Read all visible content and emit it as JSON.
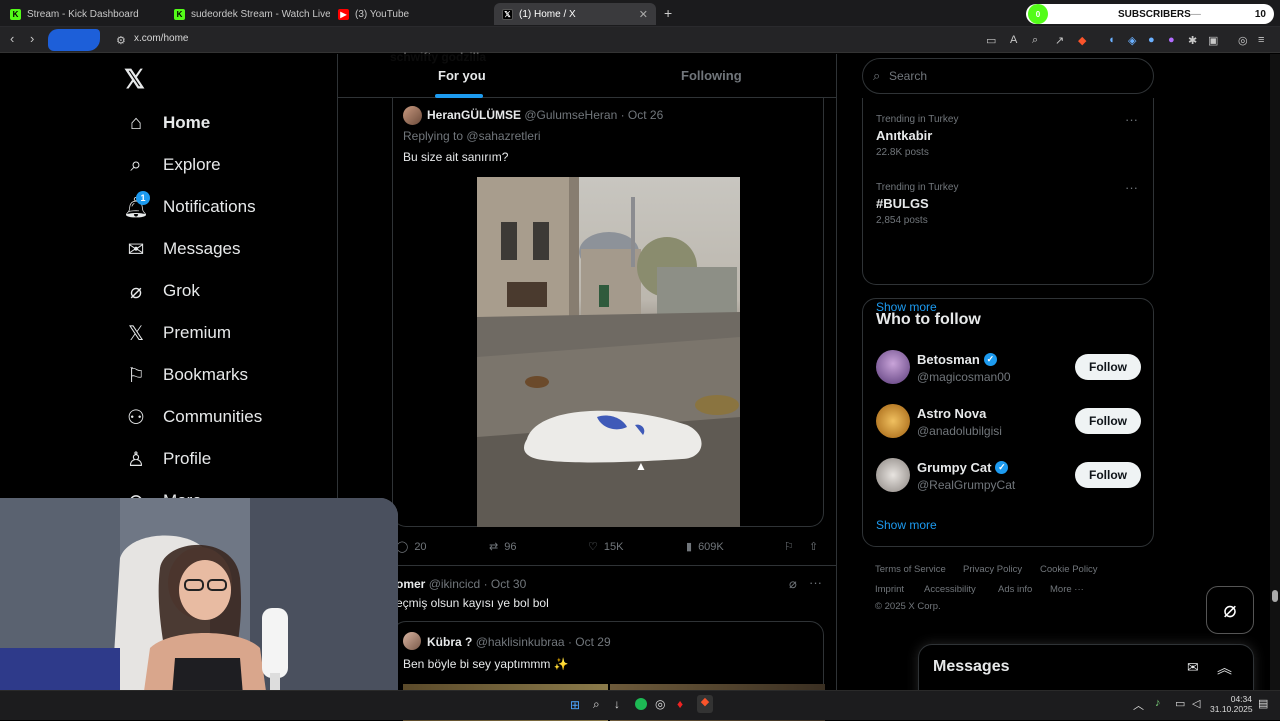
{
  "browser": {
    "tabs": [
      {
        "title": "Stream - Kick Dashboard",
        "icon": "kick-icon"
      },
      {
        "title": "sudeordek Stream - Watch Live on Kick",
        "icon": "kick-icon"
      },
      {
        "title": "(3) YouTube",
        "icon": "youtube-icon"
      },
      {
        "title": "(1) Home / X",
        "icon": "x-icon",
        "close": "✕"
      }
    ],
    "new_tab": "+",
    "subs_label": "SUBSCRIBERS",
    "subs_count": "10",
    "subs_progress": "0",
    "url": "x.com/home"
  },
  "nav": {
    "items": [
      {
        "label": "Home",
        "icon": "home-icon"
      },
      {
        "label": "Explore",
        "icon": "search-icon"
      },
      {
        "label": "Notifications",
        "icon": "bell-icon",
        "badge": "1"
      },
      {
        "label": "Messages",
        "icon": "mail-icon"
      },
      {
        "label": "Grok",
        "icon": "grok-icon"
      },
      {
        "label": "Premium",
        "icon": "x-icon"
      },
      {
        "label": "Bookmarks",
        "icon": "bookmark-icon"
      },
      {
        "label": "Communities",
        "icon": "people-icon"
      },
      {
        "label": "Profile",
        "icon": "person-icon"
      },
      {
        "label": "More",
        "icon": "more-circle-icon"
      }
    ]
  },
  "feed": {
    "tab_for_you": "For you",
    "tab_following": "Following",
    "faded_header": "schwifty godzilla",
    "post1": {
      "name": "HeranGÜLÜMSE",
      "handle": "@GulumseHeran",
      "date": "· Oct 26",
      "reply_prefix": "Replying to",
      "reply_handle": "@sahazretleri",
      "text": "Bu size ait sanırım?",
      "replies": "20",
      "reposts": "96",
      "likes": "15K",
      "views": "609K"
    },
    "post2": {
      "name": "omer",
      "handle": "@ikincicd",
      "date": "· Oct 30",
      "text": "eçmiş olsun kayısı ye bol bol"
    },
    "post3": {
      "name": "Kübra ?",
      "handle": "@haklisinkubraa",
      "date": "· Oct 29",
      "text": "Ben böyle bi sey yaptımmm ✨"
    }
  },
  "right": {
    "search_placeholder": "Search",
    "trends": [
      {
        "category": "Trending in Turkey",
        "name": "Anıtkabir",
        "posts": "22.8K posts"
      },
      {
        "category": "Trending in Turkey",
        "name": "#BULGS",
        "posts": "2,854 posts"
      }
    ],
    "show_more": "Show more",
    "wtf_title": "Who to follow",
    "wtf": [
      {
        "name": "Betosman",
        "handle": "@magicosman00",
        "verified": true
      },
      {
        "name": "Astro Nova",
        "handle": "@anadolubilgisi",
        "verified": false
      },
      {
        "name": "Grumpy Cat",
        "handle": "@RealGrumpyCat",
        "verified": true
      }
    ],
    "follow_label": "Follow",
    "wtf_show_more": "Show more",
    "footer": [
      "Terms of Service",
      "Privacy Policy",
      "Cookie Policy",
      "Imprint",
      "Accessibility",
      "Ads info",
      "More ···",
      "© 2025 X Corp."
    ]
  },
  "messages_dock": {
    "title": "Messages"
  },
  "taskbar": {
    "time": "04:34",
    "date": "31.10.2025"
  },
  "colors": {
    "accent": "#1d9bf0",
    "kick": "#53fc18",
    "bg": "#000000",
    "border": "#2f3336"
  }
}
